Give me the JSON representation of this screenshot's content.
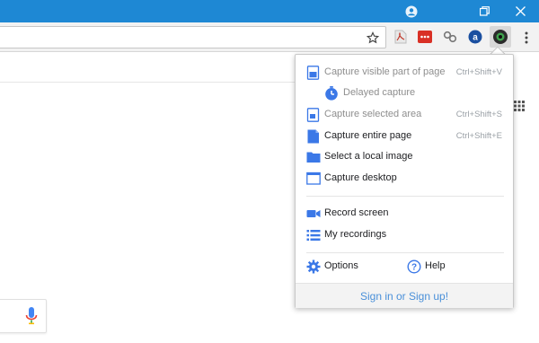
{
  "window": {
    "titlebar_color": "#1e88d4",
    "controls": [
      "account-icon",
      "restore-icon",
      "close-icon"
    ]
  },
  "toolbar": {
    "extensions": [
      "pdf-icon",
      "red-extension-icon",
      "link-icon",
      "a-extension-icon",
      "camera-extension-icon"
    ],
    "menu_icon": "kebab-menu-icon"
  },
  "popup": {
    "accent": "#3b78e7",
    "items": [
      {
        "label": "Capture visible part of page",
        "shortcut": "Ctrl+Shift+V",
        "icon": "capture-visible-icon",
        "enabled": false
      },
      {
        "label": "Delayed capture",
        "shortcut": "",
        "icon": "timer-icon",
        "enabled": false
      },
      {
        "label": "Capture selected area",
        "shortcut": "Ctrl+Shift+S",
        "icon": "capture-area-icon",
        "enabled": false
      },
      {
        "label": "Capture entire page",
        "shortcut": "Ctrl+Shift+E",
        "icon": "capture-entire-icon",
        "enabled": true
      },
      {
        "label": "Select a local image",
        "shortcut": "",
        "icon": "folder-icon",
        "enabled": true
      },
      {
        "label": "Capture desktop",
        "shortcut": "",
        "icon": "desktop-icon",
        "enabled": true
      },
      {
        "label": "Record screen",
        "shortcut": "",
        "icon": "video-camera-icon",
        "enabled": true
      },
      {
        "label": "My recordings",
        "shortcut": "",
        "icon": "list-icon",
        "enabled": true
      }
    ],
    "options_label": "Options",
    "help_label": "Help",
    "signin_label": "Sign in or Sign up!"
  }
}
